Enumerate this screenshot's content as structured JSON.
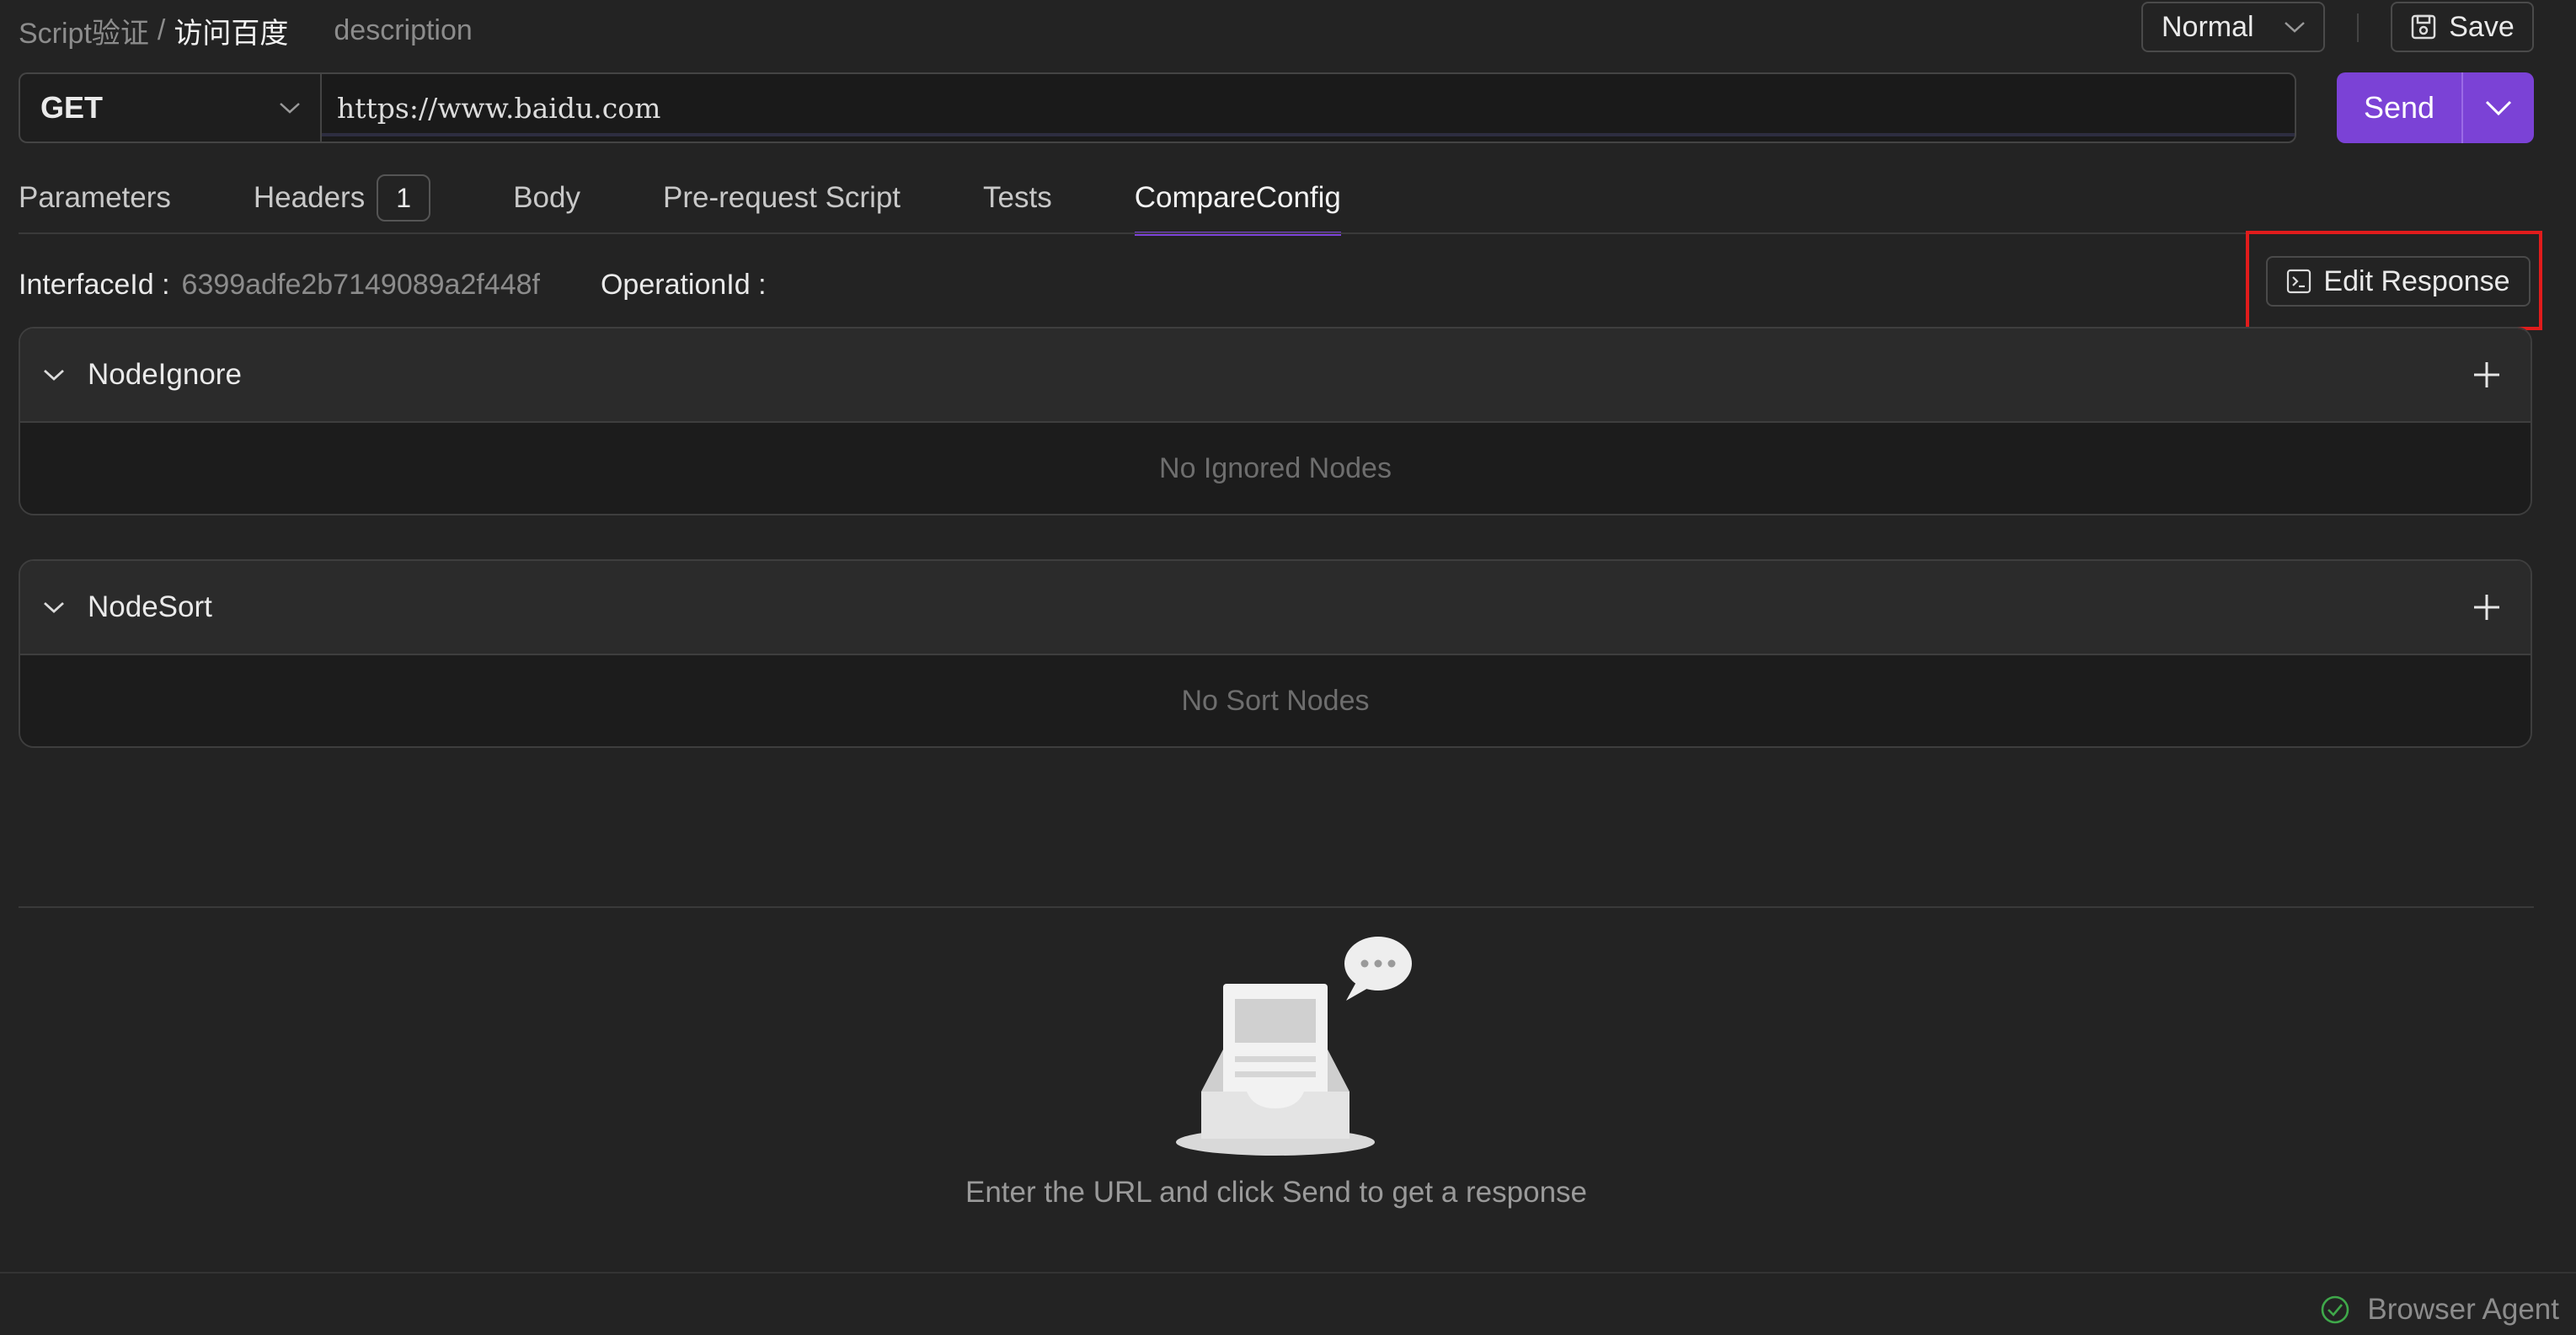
{
  "breadcrumb": {
    "parent": "Script验证",
    "separator": "/",
    "current": "访问百度",
    "description": "description"
  },
  "environment": {
    "selected": "Normal"
  },
  "toolbar": {
    "save_label": "Save"
  },
  "request": {
    "method": "GET",
    "url": "https://www.baidu.com",
    "send_label": "Send"
  },
  "tabs": [
    {
      "label": "Parameters"
    },
    {
      "label": "Headers",
      "badge": "1"
    },
    {
      "label": "Body"
    },
    {
      "label": "Pre-request Script"
    },
    {
      "label": "Tests"
    },
    {
      "label": "CompareConfig",
      "active": true
    }
  ],
  "info": {
    "interface_label": "InterfaceId :",
    "interface_value": "6399adfe2b7149089a2f448f",
    "operation_label": "OperationId :",
    "operation_value": ""
  },
  "edit_response_label": "Edit Response",
  "panels": {
    "node_ignore": {
      "title": "NodeIgnore",
      "empty": "No Ignored Nodes"
    },
    "node_sort": {
      "title": "NodeSort",
      "empty": "No Sort Nodes"
    }
  },
  "response": {
    "empty_text": "Enter the URL and click Send to get a response"
  },
  "statusbar": {
    "agent_label": "Browser Agent"
  },
  "colors": {
    "accent": "#7b42d6",
    "highlight": "#e11c1c",
    "success": "#3fa84a"
  }
}
